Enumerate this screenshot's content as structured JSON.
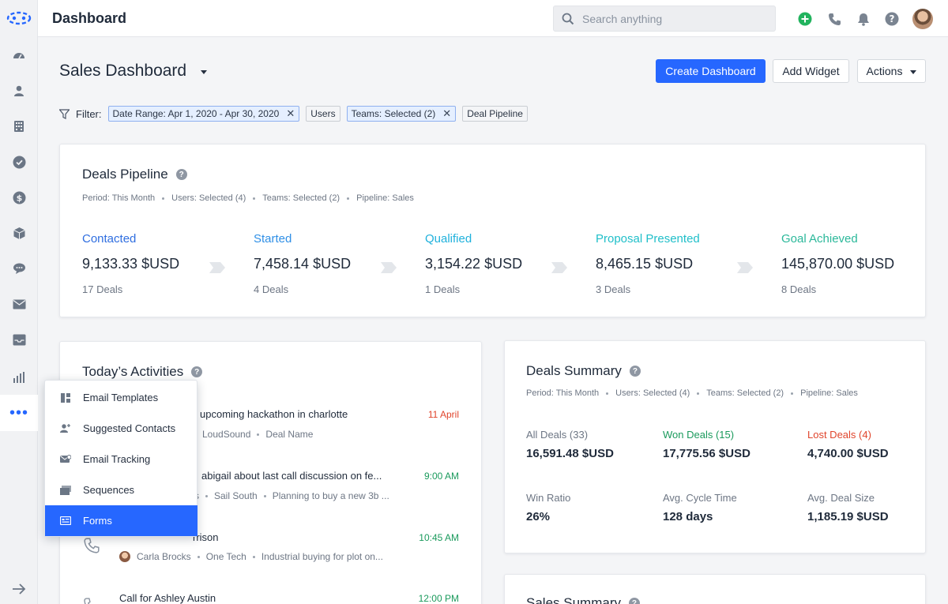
{
  "header": {
    "title": "Dashboard",
    "search_placeholder": "Search anything"
  },
  "page": {
    "title": "Sales Dashboard",
    "create_button": "Create Dashboard",
    "add_widget_button": "Add Widget",
    "actions_button": "Actions"
  },
  "filter": {
    "label": "Filter:",
    "chips": [
      {
        "label": "Date Range: Apr 1, 2020 - Apr 30, 2020",
        "active": true,
        "removable": true
      },
      {
        "label": "Users",
        "active": false,
        "removable": false
      },
      {
        "label": "Teams: Selected (2)",
        "active": true,
        "removable": true
      },
      {
        "label": "Deal Pipeline",
        "active": false,
        "removable": false
      }
    ],
    "remove_glyph": "✕"
  },
  "pipeline": {
    "title": "Deals Pipeline",
    "help": "?",
    "meta": [
      "Period: This Month",
      "Users: Selected (4)",
      "Teams: Selected (2)",
      "Pipeline: Sales"
    ],
    "stages": [
      {
        "name": "Contacted",
        "amount": "9,133.33 $USD",
        "deals": "17 Deals",
        "color": "#2f6ee0"
      },
      {
        "name": "Started",
        "amount": "7,458.14 $USD",
        "deals": "4 Deals",
        "color": "#2f8fe6"
      },
      {
        "name": "Qualified",
        "amount": "3,154.22 $USD",
        "deals": "1 Deals",
        "color": "#1fb1dc"
      },
      {
        "name": "Proposal Presented",
        "amount": "8,465.15 $USD",
        "deals": "3 Deals",
        "color": "#20bfc9"
      },
      {
        "name": "Goal Achieved",
        "amount": "145,870.00 $USD",
        "deals": "8 Deals",
        "color": "#2bb89a"
      }
    ]
  },
  "activities": {
    "title": "Today’s Activities",
    "help": "?",
    "items": [
      {
        "title": "upcoming hackathon in charlotte",
        "time": "11 April",
        "time_color": "#e0452c",
        "meta": [
          "LoudSound",
          "Deal Name"
        ]
      },
      {
        "title": "abigail about last call discussion on fe...",
        "time": "9:00 AM",
        "time_color": "#1a9a5c",
        "meta": [
          "Sail South",
          "Planning to buy a new 3b ..."
        ]
      },
      {
        "title": "rrison",
        "time": "10:45 AM",
        "time_color": "#1a9a5c",
        "meta": [
          "Carla Brocks",
          "One Tech",
          "Industrial buying for plot on..."
        ]
      },
      {
        "title": "Call for Ashley Austin",
        "time": "12:00 PM",
        "time_color": "#1a9a5c",
        "meta": []
      }
    ],
    "meta_partial": "s"
  },
  "summary": {
    "title": "Deals Summary",
    "help": "?",
    "meta": [
      "Period: This Month",
      "Users: Selected (4)",
      "Teams: Selected (2)",
      "Pipeline: Sales"
    ],
    "cells": [
      {
        "label": "All Deals (33)",
        "value": "16,591.48 $USD",
        "label_color": "#6d7684"
      },
      {
        "label": "Won Deals (15)",
        "value": "17,775.56 $USD",
        "label_color": "#1a9a5c"
      },
      {
        "label": "Lost Deals (4)",
        "value": "4,740.00 $USD",
        "label_color": "#e0452c"
      },
      {
        "label": "Win Ratio",
        "value": "26%",
        "label_color": "#6d7684"
      },
      {
        "label": "Avg. Cycle Time",
        "value": "128 days",
        "label_color": "#6d7684"
      },
      {
        "label": "Avg. Deal Size",
        "value": "1,185.19 $USD",
        "label_color": "#6d7684"
      }
    ]
  },
  "sales_summary": {
    "title": "Sales Summary"
  },
  "more_menu": {
    "trigger": "•••",
    "items": [
      {
        "label": "Email Templates",
        "icon": "template-icon",
        "selected": false
      },
      {
        "label": "Suggested Contacts",
        "icon": "add-contact-icon",
        "selected": false
      },
      {
        "label": "Email Tracking",
        "icon": "tracking-icon",
        "selected": false
      },
      {
        "label": "Sequences",
        "icon": "sequences-icon",
        "selected": false
      },
      {
        "label": "Forms",
        "icon": "forms-icon",
        "selected": true
      }
    ]
  },
  "colors": {
    "accent": "#2667ff",
    "green": "#1a9a5c",
    "red": "#e0452c"
  }
}
